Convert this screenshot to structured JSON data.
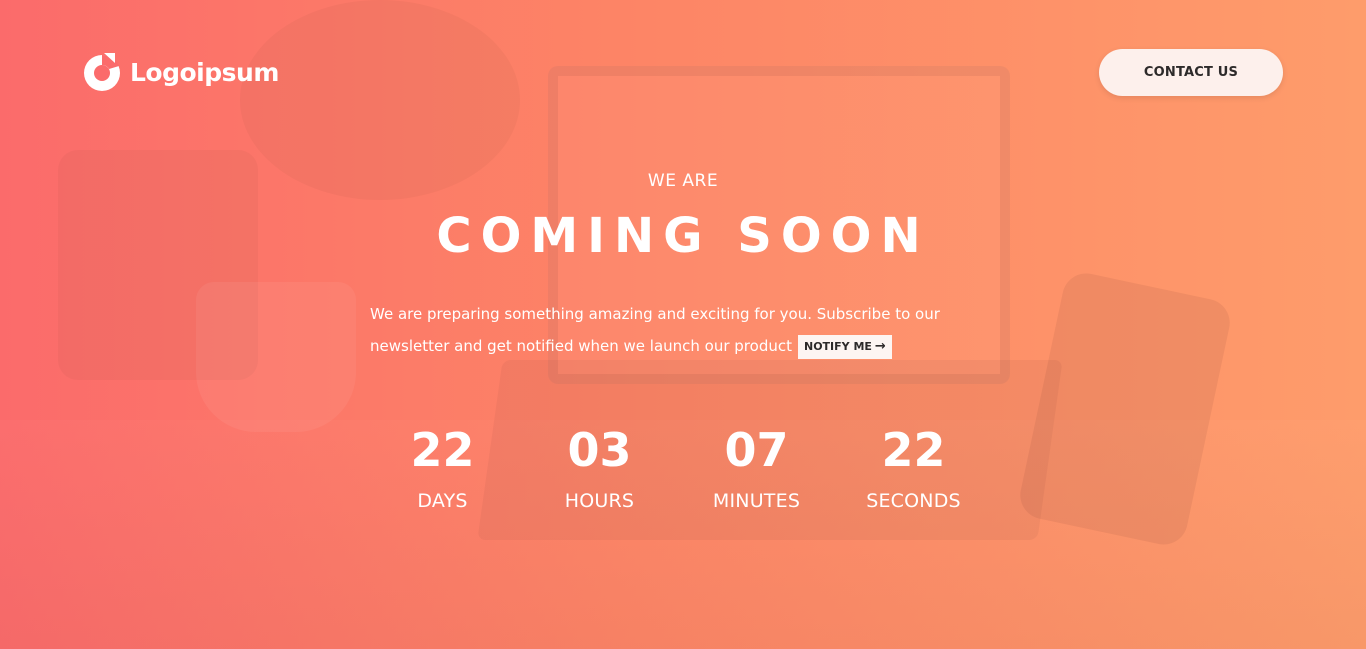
{
  "brand": {
    "name": "Logoipsum",
    "logo_icon": "logo-ring-icon"
  },
  "header": {
    "contact_label": "CONTACT US"
  },
  "hero": {
    "eyebrow": "WE ARE",
    "title": "COMING SOON",
    "description_line1": "We are preparing something amazing and exciting for you. Subscribe to our",
    "description_line2": "newsletter and get notified when we launch our product",
    "notify_label": "NOTIFY ME",
    "notify_arrow": "→"
  },
  "countdown": [
    {
      "value": "22",
      "label": "DAYS"
    },
    {
      "value": "03",
      "label": "HOURS"
    },
    {
      "value": "07",
      "label": "MINUTES"
    },
    {
      "value": "22",
      "label": "SECONDS"
    }
  ],
  "colors": {
    "gradient_start": "#fb6b6b",
    "gradient_end": "#fe9c6b",
    "button_bg": "#fdf0ec",
    "button_text": "#2d2a2a"
  }
}
